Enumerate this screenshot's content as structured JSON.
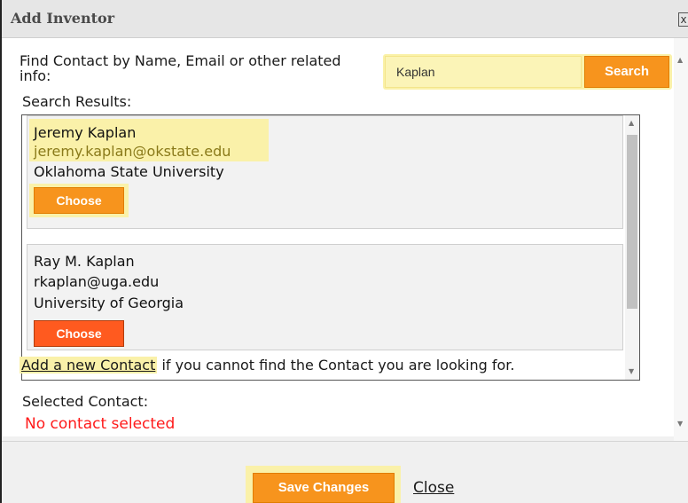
{
  "dialog": {
    "title": "Add Inventor",
    "close_glyph": "x"
  },
  "search": {
    "label": "Find Contact by Name, Email or other related info:",
    "value": "Kaplan",
    "button_label": "Search"
  },
  "results": {
    "label": "Search Results:",
    "items": [
      {
        "name": "Jeremy Kaplan",
        "email": "jeremy.kaplan@okstate.edu",
        "organization": "Oklahoma State University",
        "choose_label": "Choose"
      },
      {
        "name": "Ray M. Kaplan",
        "email": "rkaplan@uga.edu",
        "organization": "University of Georgia",
        "choose_label": "Choose"
      }
    ]
  },
  "add_contact": {
    "link_text": "Add a new Contact",
    "trailing_text": " if you cannot find the Contact you are looking for."
  },
  "selected": {
    "label": "Selected Contact:",
    "value": "No contact selected"
  },
  "footer": {
    "save_label": "Save Changes",
    "close_label": "Close"
  },
  "colors": {
    "accent": "#f7941d",
    "choose_active": "#ff5a1f",
    "highlight": "#faf1a9",
    "error": "#ff1a1a"
  },
  "icons": {
    "close": "close-icon",
    "scroll_up": "arrow-up-icon",
    "scroll_down": "arrow-down-icon",
    "scroll_left": "arrow-left-icon",
    "scroll_right": "arrow-right-icon"
  }
}
